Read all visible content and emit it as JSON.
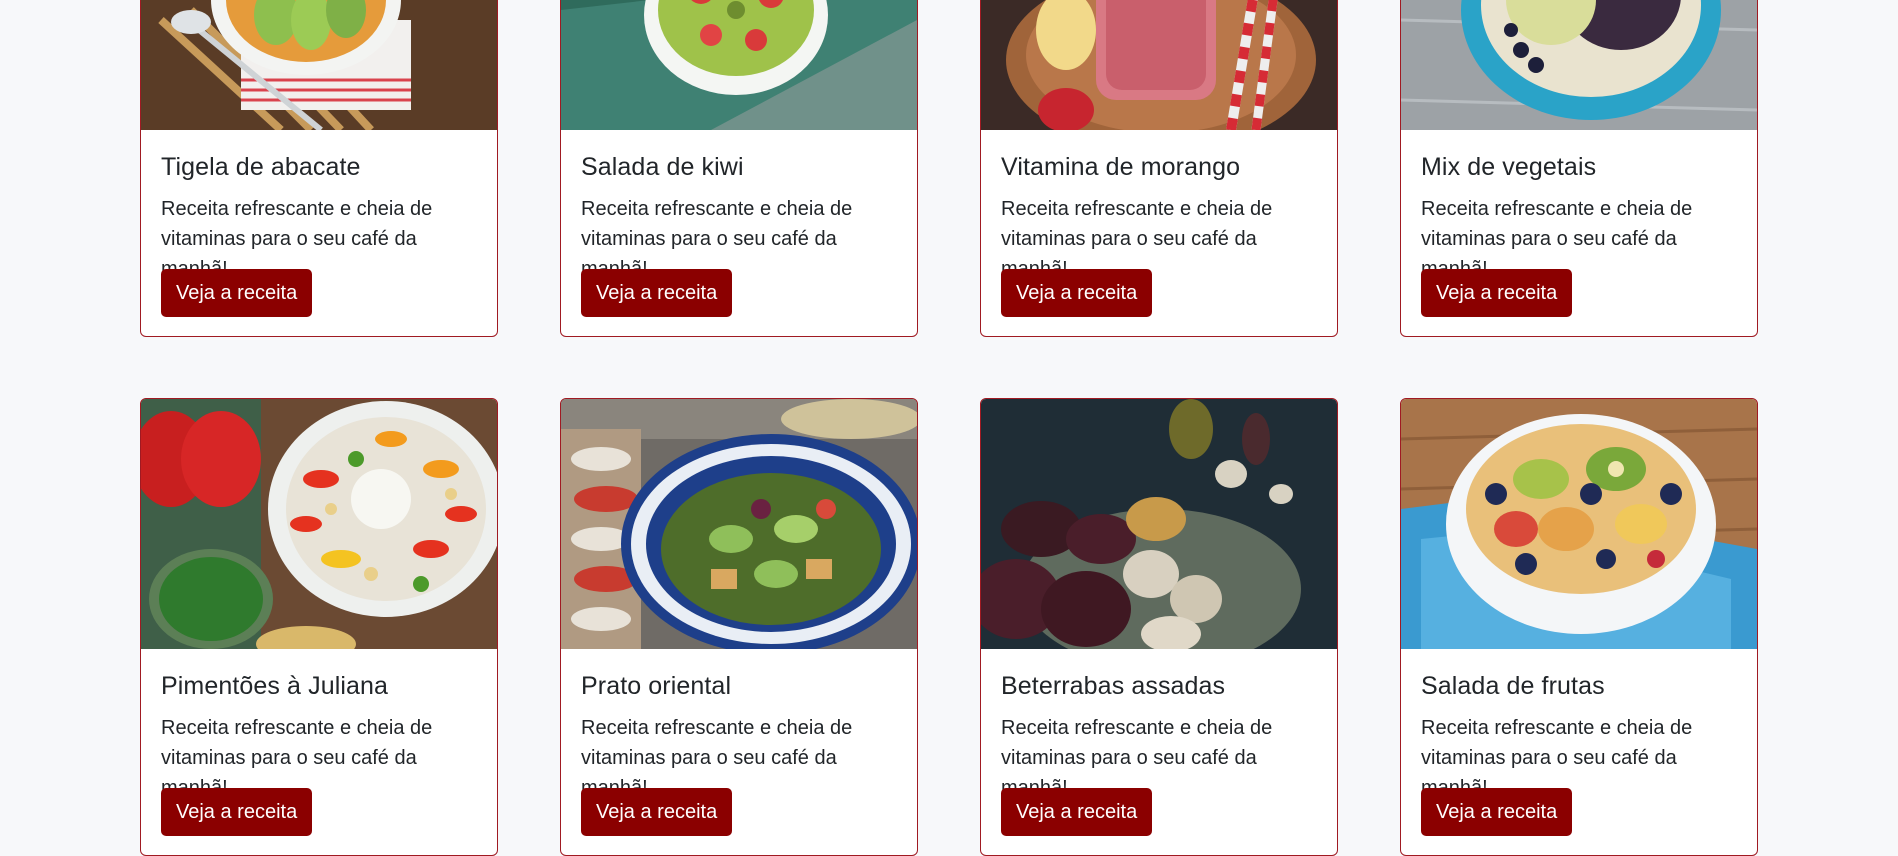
{
  "cards": [
    {
      "title": "Tigela de abacate",
      "description": "Receita refrescante e cheia de vitaminas para o seu café da manhã!",
      "button_label": "Veja a receita",
      "image": "avocado-bowl-photo"
    },
    {
      "title": "Salada de kiwi",
      "description": "Receita refrescante e cheia de vitaminas para o seu café da manhã!",
      "button_label": "Veja a receita",
      "image": "kiwi-bowl-photo"
    },
    {
      "title": "Vitamina de morango",
      "description": "Receita refrescante e cheia de vitaminas para o seu café da manhã!",
      "button_label": "Veja a receita",
      "image": "strawberry-smoothie-photo"
    },
    {
      "title": "Mix de vegetais",
      "description": "Receita refrescante e cheia de vitaminas para o seu café da manhã!",
      "button_label": "Veja a receita",
      "image": "vegetable-mix-photo"
    },
    {
      "title": "Pimentões à Juliana",
      "description": "Receita refrescante e cheia de vitaminas para o seu café da manhã!",
      "button_label": "Veja a receita",
      "image": "pepper-salad-photo"
    },
    {
      "title": "Prato oriental",
      "description": "Receita refrescante e cheia de vitaminas para o seu café da manhã!",
      "button_label": "Veja a receita",
      "image": "oriental-salad-photo"
    },
    {
      "title": "Beterrabas assadas",
      "description": "Receita refrescante e cheia de vitaminas para o seu café da manhã!",
      "button_label": "Veja a receita",
      "image": "roasted-beets-photo"
    },
    {
      "title": "Salada de frutas",
      "description": "Receita refrescante e cheia de vitaminas para o seu café da manhã!",
      "button_label": "Veja a receita",
      "image": "fruit-salad-photo"
    }
  ],
  "colors": {
    "accent": "#8b0000",
    "card_border": "#a01a22",
    "background": "#f7f8fa",
    "text": "#212529"
  }
}
